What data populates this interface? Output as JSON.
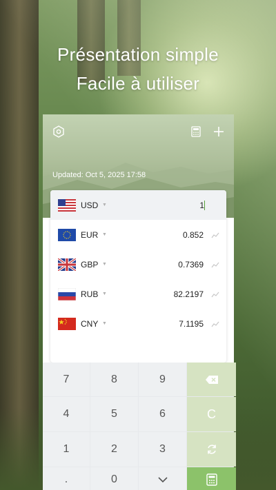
{
  "promo": {
    "line1": "Présentation simple",
    "line2": "Facile à utiliser"
  },
  "header": {
    "updated": "Updated: Oct 5, 2025 17:58",
    "icons": [
      "settings-icon",
      "calculator-icon",
      "add-icon"
    ]
  },
  "currencies": [
    {
      "code": "USD",
      "value": "1",
      "flag": "us"
    },
    {
      "code": "EUR",
      "value": "0.852",
      "flag": "eu"
    },
    {
      "code": "GBP",
      "value": "0.7369",
      "flag": "gb"
    },
    {
      "code": "RUB",
      "value": "82.2197",
      "flag": "ru"
    },
    {
      "code": "CNY",
      "value": "7.1195",
      "flag": "cn"
    }
  ],
  "keypad": {
    "k7": "7",
    "k8": "8",
    "k9": "9",
    "k4": "4",
    "k5": "5",
    "k6": "6",
    "k1": "1",
    "k2": "2",
    "k3": "3",
    "kdot": ".",
    "k0": "0",
    "clear": "C"
  },
  "colors": {
    "accent": "#8cc26a",
    "func_key": "#d6e3c2"
  }
}
